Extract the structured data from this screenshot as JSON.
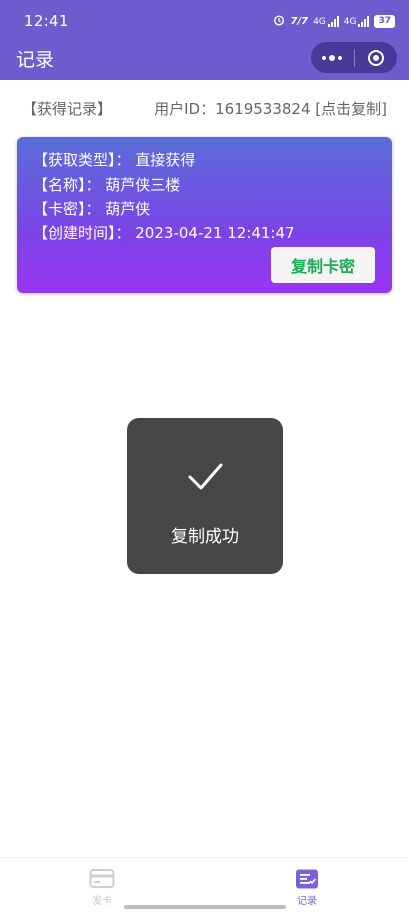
{
  "status_bar": {
    "time": "12:41",
    "network_label": "4G",
    "battery": "37"
  },
  "nav": {
    "title": "记录"
  },
  "records": {
    "header_left": "【获得记录】",
    "user_id_label": "用户ID：1619533824 [点击复制]"
  },
  "card": {
    "type_line": "【获取类型】：  直接获得",
    "name_line": "【名称】：  葫芦侠三楼",
    "key_line": "【卡密】：  葫芦侠",
    "created_line": "【创建时间】：  2023-04-21 12:41:47",
    "copy_button": "复制卡密",
    "colors": {
      "gradient_top": "#5a6ed8",
      "gradient_bottom": "#9a35f2",
      "button_text": "#1aad55"
    }
  },
  "toast": {
    "text": "复制成功",
    "icon": "checkmark-icon"
  },
  "tabbar": {
    "items": [
      {
        "label": "发卡",
        "icon": "card-icon",
        "active": false
      },
      {
        "label": "记录",
        "icon": "list-icon",
        "active": true
      }
    ]
  },
  "colors": {
    "header_bg": "#6c5ccd",
    "active_tab": "#7a63d8"
  }
}
